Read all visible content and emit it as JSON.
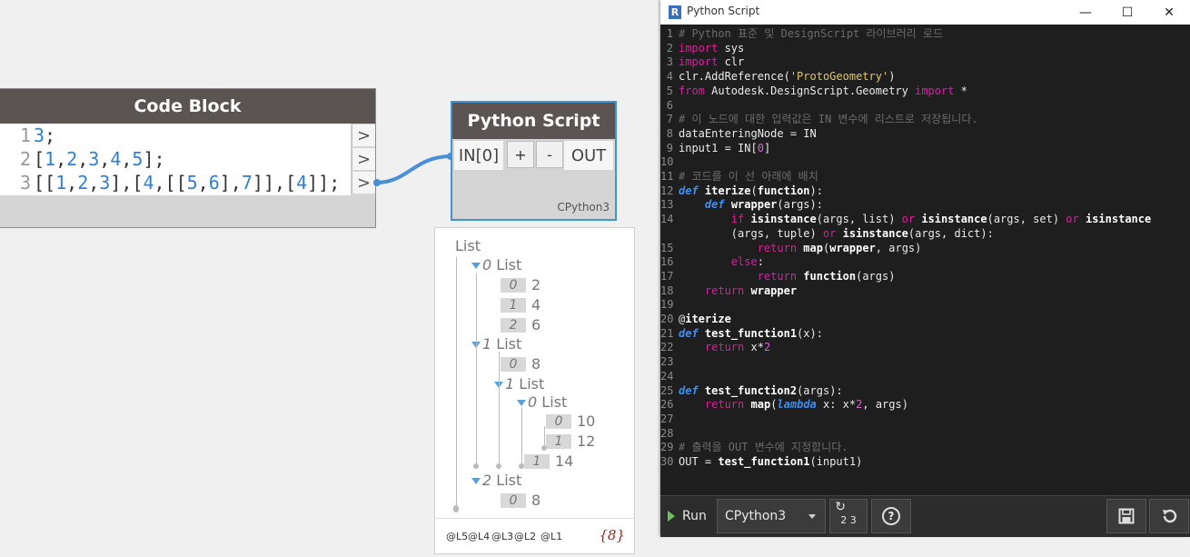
{
  "code_block": {
    "title": "Code Block",
    "lines": [
      {
        "num": "1",
        "text": "3;"
      },
      {
        "num": "2",
        "text": "[1,2,3,4,5];"
      },
      {
        "num": "3",
        "text": "[[1,2,3],[4,[[5,6],7]],[4]];"
      }
    ],
    "port_glyph": ">"
  },
  "python_node": {
    "title": "Python Script",
    "input_label": "IN[0]",
    "add_label": "+",
    "remove_label": "-",
    "output_label": "OUT",
    "engine": "CPython3"
  },
  "preview": {
    "root": "List",
    "items": [
      {
        "type": "list",
        "index": "0",
        "label": "List"
      },
      {
        "type": "val",
        "index": "0",
        "value": "2"
      },
      {
        "type": "val",
        "index": "1",
        "value": "4"
      },
      {
        "type": "val",
        "index": "2",
        "value": "6"
      },
      {
        "type": "list",
        "index": "1",
        "label": "List"
      },
      {
        "type": "val",
        "index": "0",
        "value": "8"
      },
      {
        "type": "list",
        "index": "1",
        "label": "List"
      },
      {
        "type": "list",
        "index": "0",
        "label": "List"
      },
      {
        "type": "val",
        "index": "0",
        "value": "10"
      },
      {
        "type": "val",
        "index": "1",
        "value": "12"
      },
      {
        "type": "val",
        "index": "1",
        "value": "14"
      },
      {
        "type": "list",
        "index": "2",
        "label": "List"
      },
      {
        "type": "val",
        "index": "0",
        "value": "8"
      }
    ],
    "levels": [
      "@L5",
      "@L4",
      "@L3",
      "@L2",
      "@L1"
    ],
    "count": "{8}"
  },
  "editor": {
    "window_title": "Python Script",
    "app_icon_letter": "R",
    "window_buttons": {
      "minimize": "—",
      "maximize": "☐",
      "close": "✕"
    },
    "code_lines": [
      "1|# Python 표준 및 DesignScript 라이브러리 로드",
      "2|import sys",
      "3|import clr",
      "4|clr.AddReference('ProtoGeometry')",
      "5|from Autodesk.DesignScript.Geometry import *",
      "6|",
      "7|# 이 노드에 대한 입력값은 IN 변수에 리스트로 저장됩니다.",
      "8|dataEnteringNode = IN",
      "9|input1 = IN[0]",
      "10|",
      "11|# 코드를 이 선 아래에 배치",
      "12|def iterize(function):",
      "13|    def wrapper(args):",
      "14|        if isinstance(args, list) or isinstance(args, set) or isinstance",
      "|        (args, tuple) or isinstance(args, dict):",
      "15|            return map(wrapper, args)",
      "16|        else:",
      "17|            return function(args)",
      "18|    return wrapper",
      "19|",
      "20|@iterize",
      "21|def test_function1(x):",
      "22|    return x*2",
      "23|",
      "24|",
      "25|def test_function2(args):",
      "26|    return map(lambda x: x*2, args)",
      "27|",
      "28|",
      "29|# 출력을 OUT 변수에 지정합니다.",
      "30|OUT = test_function1(input1)"
    ],
    "toolbar": {
      "run_label": "Run",
      "engine_value": "CPython3",
      "convert_glyph": "2 3",
      "help_glyph": "?"
    }
  },
  "colors": {
    "node_header": "#5a5553",
    "selection_blue": "#3f94d6",
    "editor_bg": "#1e1e1e",
    "keyword": "#d3219b",
    "def_keyword": "#3f8ff0",
    "string": "#e0c56b",
    "number": "#e05ae0",
    "comment": "#6b6b6b"
  }
}
